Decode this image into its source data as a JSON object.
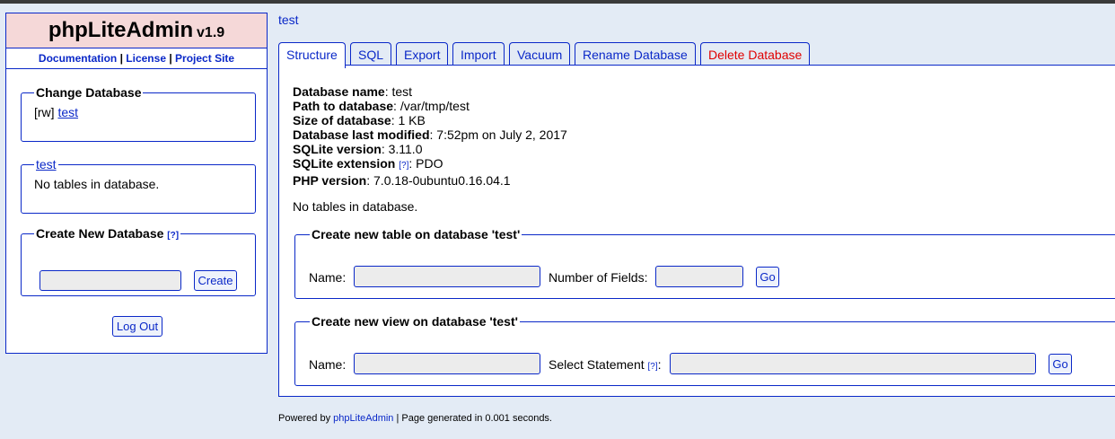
{
  "sidebar": {
    "app_name": "phpLiteAdmin",
    "version": "v1.9",
    "links": [
      "Documentation",
      "License",
      "Project Site"
    ],
    "link_sep": "|",
    "change_db": {
      "legend": "Change Database",
      "mode": "[rw]",
      "db_link": "test"
    },
    "tables_box": {
      "legend": "test",
      "empty_text": "No tables in database."
    },
    "create_db": {
      "legend": "Create New Database",
      "help": "[?]",
      "input_value": "",
      "button": "Create"
    },
    "logout": "Log Out"
  },
  "breadcrumb": "test",
  "tabs": [
    {
      "label": "Structure",
      "active": true
    },
    {
      "label": "SQL",
      "active": false
    },
    {
      "label": "Export",
      "active": false
    },
    {
      "label": "Import",
      "active": false
    },
    {
      "label": "Vacuum",
      "active": false
    },
    {
      "label": "Rename Database",
      "active": false
    },
    {
      "label": "Delete Database",
      "active": false,
      "danger": true
    }
  ],
  "db_info": {
    "name": {
      "label": "Database name",
      "value": "test"
    },
    "path": {
      "label": "Path to database",
      "value": "/var/tmp/test"
    },
    "size": {
      "label": "Size of database",
      "value": "1 KB"
    },
    "modified": {
      "label": "Database last modified",
      "value": "7:52pm on July 2, 2017"
    },
    "sqlite_version": {
      "label": "SQLite version",
      "value": "3.11.0"
    },
    "sqlite_ext": {
      "label": "SQLite extension",
      "help": "[?]",
      "value": "PDO"
    },
    "php_version": {
      "label": "PHP version",
      "value": "7.0.18-0ubuntu0.16.04.1"
    }
  },
  "main_empty_text": "No tables in database.",
  "create_table": {
    "legend": "Create new table on database 'test'",
    "name_label": "Name:",
    "fields_label": "Number of Fields:",
    "name_value": "",
    "fields_value": "",
    "button": "Go"
  },
  "create_view": {
    "legend": "Create new view on database 'test'",
    "name_label": "Name:",
    "select_label": "Select Statement",
    "help": "[?]",
    "colon": ":",
    "name_value": "",
    "select_value": "",
    "button": "Go"
  },
  "footer": {
    "prefix": "Powered by",
    "link": "phpLiteAdmin",
    "suffix": "| Page generated in 0.001 seconds."
  },
  "colors": {
    "accent": "#0a28c8",
    "header_bg": "#f5d8d8",
    "page_bg": "#e3ebf5",
    "danger": "#e00000"
  }
}
